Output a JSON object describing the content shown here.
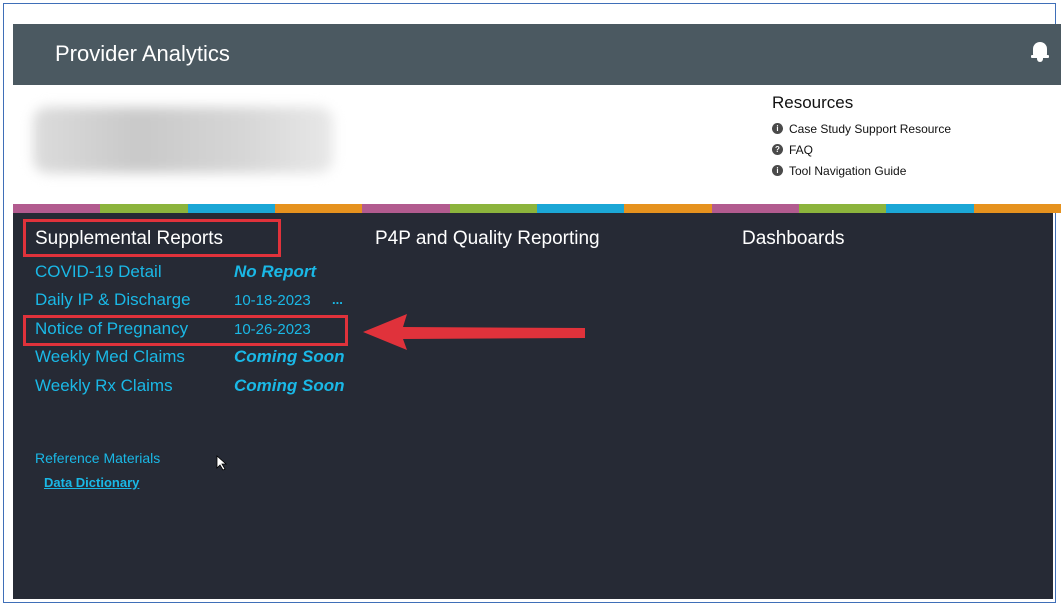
{
  "app": {
    "title": "Provider Analytics"
  },
  "header": {
    "icon": "bell-icon"
  },
  "resources": {
    "title": "Resources",
    "items": [
      {
        "label": "Case Study Support Resource",
        "icon": "info-icon",
        "glyph": "i"
      },
      {
        "label": "FAQ",
        "icon": "question-icon",
        "glyph": "?"
      },
      {
        "label": "Tool Navigation Guide",
        "icon": "info-icon",
        "glyph": "i"
      }
    ]
  },
  "stripe_colors": [
    "#b25b8f",
    "#8cb43c",
    "#1ba7d6",
    "#e6921e",
    "#b25b8f",
    "#8cb43c",
    "#1ba7d6",
    "#e6921e",
    "#b25b8f",
    "#8cb43c",
    "#1ba7d6",
    "#e6921e"
  ],
  "sections": {
    "supplemental": "Supplemental Reports",
    "p4p": "P4P and Quality Reporting",
    "dashboards": "Dashboards"
  },
  "reports": [
    {
      "name": "COVID-19 Detail",
      "status": "No Report"
    },
    {
      "name": "Daily IP & Discharge",
      "date": "10-18-2023",
      "more": "..."
    },
    {
      "name": "Notice of Pregnancy",
      "date": "10-26-2023"
    },
    {
      "name": "Weekly Med Claims",
      "status": "Coming Soon"
    },
    {
      "name": "Weekly Rx Claims",
      "status": "Coming Soon"
    }
  ],
  "reference": {
    "title": "Reference Materials",
    "link": "Data Dictionary"
  },
  "colors": {
    "header_bg": "#4b5961",
    "main_bg": "#262a35",
    "link": "#1ab8e6",
    "highlight": "#e0323b"
  }
}
